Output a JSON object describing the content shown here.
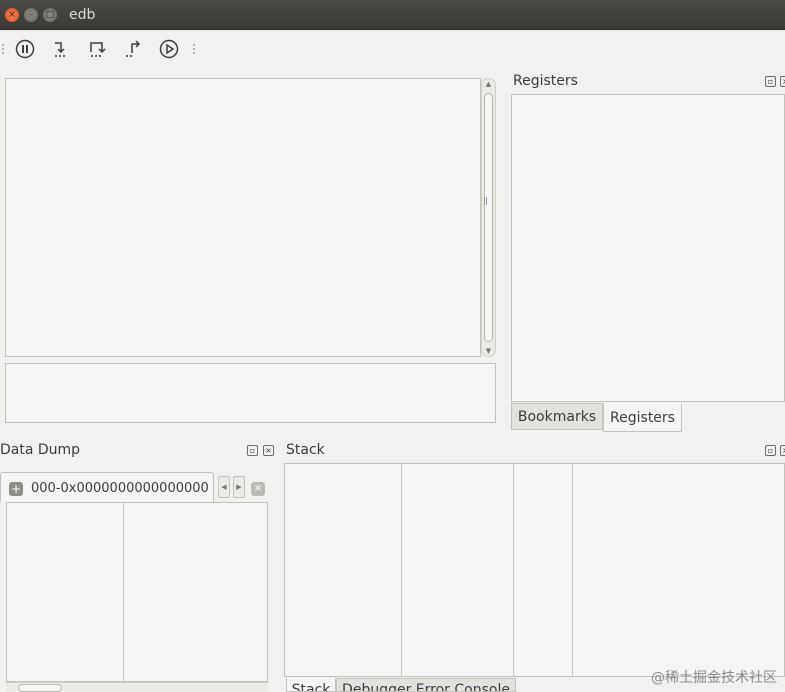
{
  "window": {
    "title": "edb",
    "close_glyph": "×",
    "min_glyph": "–",
    "max_glyph": "□"
  },
  "toolbar": {
    "buttons": [
      {
        "name": "pause-icon"
      },
      {
        "name": "step-into-icon"
      },
      {
        "name": "step-over-icon"
      },
      {
        "name": "step-out-icon"
      },
      {
        "name": "run-icon"
      }
    ]
  },
  "registers": {
    "title": "Registers",
    "tabs": [
      "Bookmarks",
      "Registers"
    ],
    "active_tab": "Registers"
  },
  "data_dump": {
    "title": "Data Dump",
    "tab_label": "000-0x0000000000000000",
    "add_glyph": "+",
    "close_glyph": "×",
    "prev_glyph": "◀",
    "next_glyph": "▶"
  },
  "stack": {
    "title": "Stack",
    "tabs": [
      "Stack",
      "Debugger Error Console"
    ]
  },
  "dock_buttons": {
    "float_glyph": "▫",
    "close_glyph": "×"
  },
  "watermark": "@稀土掘金技术社区"
}
